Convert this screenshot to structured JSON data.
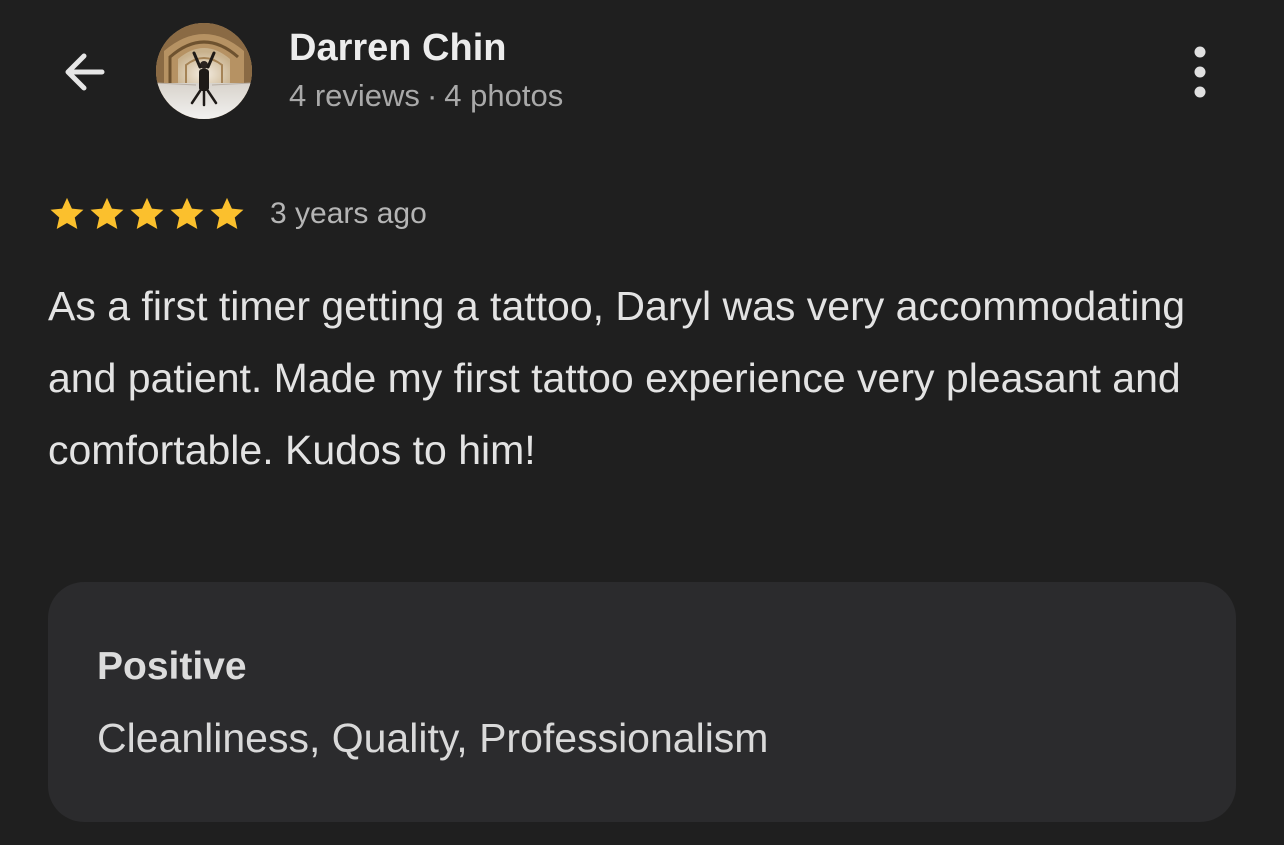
{
  "header": {
    "back_icon": "arrow-left-icon",
    "avatar_icon": "profile-photo",
    "name": "Darren Chin",
    "reviews_count": "4 reviews",
    "separator": "·",
    "photos_count": "4 photos",
    "more_icon": "more-vertical-icon"
  },
  "review": {
    "rating": 5,
    "rating_max": 5,
    "star_icon": "star-icon",
    "star_color": "#fbc02d",
    "time_ago": "3 years ago",
    "text": "As a first timer getting a tattoo, Daryl was very accommodating and patient. Made my first tattoo experience very pleasant and comfortable. Kudos to him!"
  },
  "attributes": {
    "heading": "Positive",
    "values": "Cleanliness, Quality, Professionalism"
  },
  "colors": {
    "background": "#1f1f1f",
    "card": "#2b2b2d",
    "primary_text": "#e3e3e3",
    "secondary_text": "#a9a9a9"
  }
}
